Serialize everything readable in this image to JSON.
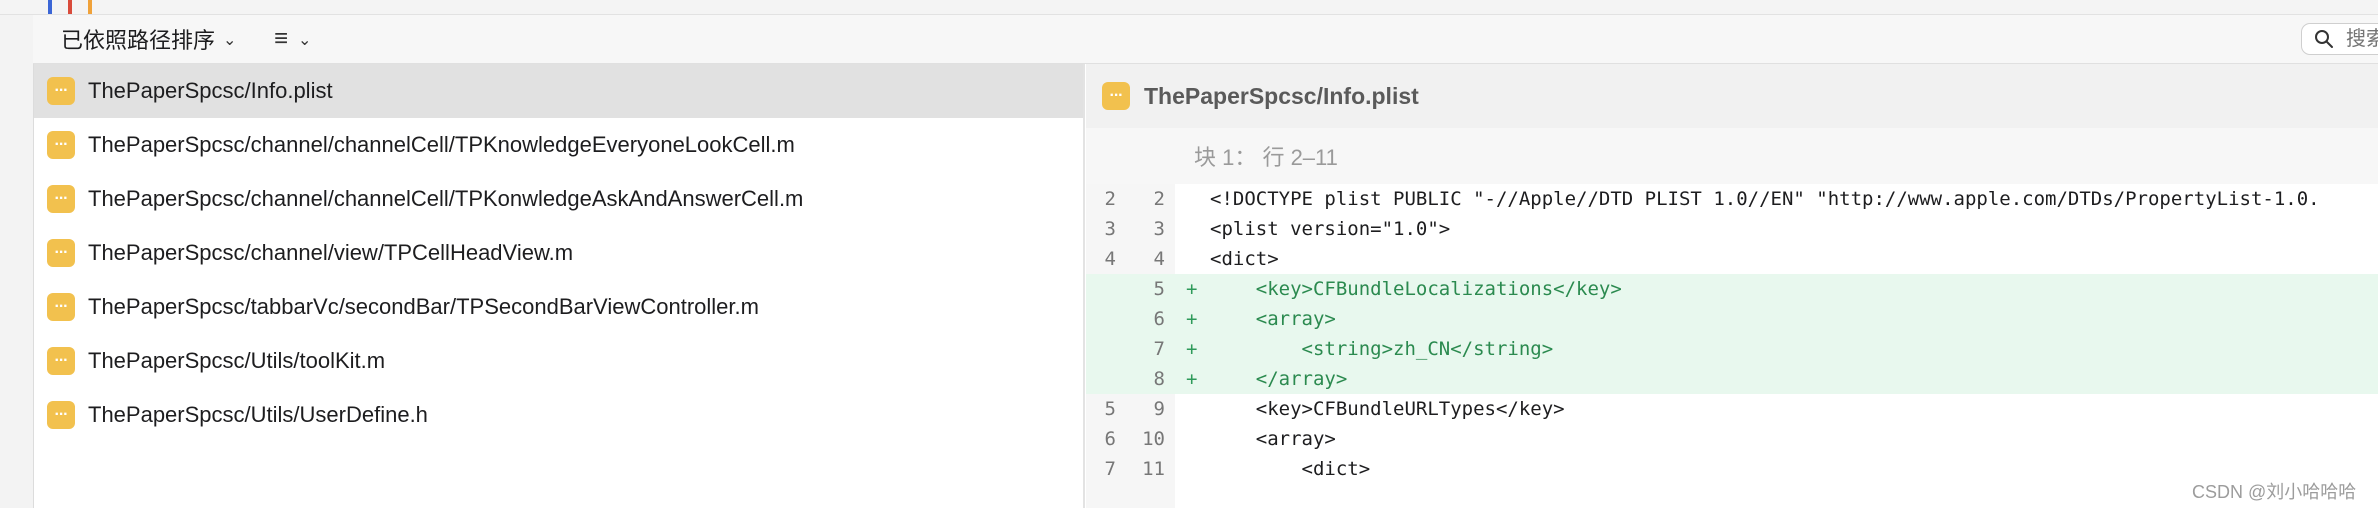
{
  "toolbar": {
    "sort_label": "已依照路径排序",
    "view_icon": "list-icon",
    "search_placeholder": "搜索"
  },
  "files": [
    {
      "path": "ThePaperSpcsc/Info.plist",
      "selected": true
    },
    {
      "path": "ThePaperSpcsc/channel/channelCell/TPKnowledgeEveryoneLookCell.m",
      "selected": false
    },
    {
      "path": "ThePaperSpcsc/channel/channelCell/TPKonwledgeAskAndAnswerCell.m",
      "selected": false
    },
    {
      "path": "ThePaperSpcsc/channel/view/TPCellHeadView.m",
      "selected": false
    },
    {
      "path": "ThePaperSpcsc/tabbarVc/secondBar/TPSecondBarViewController.m",
      "selected": false
    },
    {
      "path": "ThePaperSpcsc/Utils/toolKit.m",
      "selected": false
    },
    {
      "path": "ThePaperSpcsc/Utils/UserDefine.h",
      "selected": false
    }
  ],
  "diff": {
    "file": "ThePaperSpcsc/Info.plist",
    "chunk_label": "块 1： 行 2–11",
    "lines": [
      {
        "old": "2",
        "new": "2",
        "marker": "",
        "added": false,
        "code": "<!DOCTYPE plist PUBLIC \"-//Apple//DTD PLIST 1.0//EN\" \"http://www.apple.com/DTDs/PropertyList-1.0."
      },
      {
        "old": "3",
        "new": "3",
        "marker": "",
        "added": false,
        "code": "<plist version=\"1.0\">"
      },
      {
        "old": "4",
        "new": "4",
        "marker": "",
        "added": false,
        "code": "<dict>"
      },
      {
        "old": "",
        "new": "5",
        "marker": "+",
        "added": true,
        "code": "    <key>CFBundleLocalizations</key>"
      },
      {
        "old": "",
        "new": "6",
        "marker": "+",
        "added": true,
        "code": "    <array>"
      },
      {
        "old": "",
        "new": "7",
        "marker": "+",
        "added": true,
        "code": "        <string>zh_CN</string>"
      },
      {
        "old": "",
        "new": "8",
        "marker": "+",
        "added": true,
        "code": "    </array>"
      },
      {
        "old": "5",
        "new": "9",
        "marker": "",
        "added": false,
        "code": "    <key>CFBundleURLTypes</key>"
      },
      {
        "old": "6",
        "new": "10",
        "marker": "",
        "added": false,
        "code": "    <array>"
      },
      {
        "old": "7",
        "new": "11",
        "marker": "",
        "added": false,
        "code": "        <dict>"
      }
    ]
  },
  "watermark": "CSDN @刘小哈哈哈",
  "colors": {
    "file_icon": "#f2c14e",
    "added_bg": "#e8f8ee",
    "added_text": "#2b8a4f",
    "selected_row": "#e1e1e1"
  }
}
